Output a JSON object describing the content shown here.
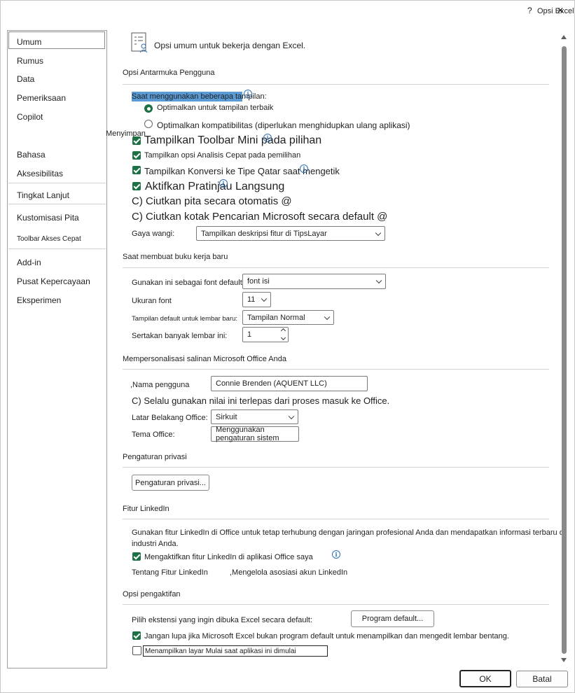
{
  "window": {
    "title": "Opsi Excel",
    "help": "?",
    "close": "✕"
  },
  "sidebar": {
    "items": [
      {
        "label": "Umum"
      },
      {
        "label": "Rumus"
      },
      {
        "label": "Data"
      },
      {
        "label": "Pemeriksaan"
      },
      {
        "label": "Copilot"
      },
      {
        "label": "Menyimpan"
      },
      {
        "label": "Bahasa"
      },
      {
        "label": "Aksesibilitas"
      },
      {
        "label": "Tingkat Lanjut"
      },
      {
        "label": "Kustomisasi Pita"
      },
      {
        "label": "Toolbar Akses Cepat"
      },
      {
        "label": "Add-in"
      },
      {
        "label": "Pusat Kepercayaan"
      },
      {
        "label": "Eksperimen"
      }
    ]
  },
  "header": {
    "title": "Opsi umum untuk bekerja dengan Excel."
  },
  "ui_section": {
    "title": "Opsi Antarmuka Pengguna",
    "multi_display_label": "Saat menggunakan beberapa tampilan:",
    "radio_best": "Optimalkan untuk tampilan terbaik",
    "radio_compat": "Optimalkan kompatibilitas (diperlukan menghidupkan ulang aplikasi)",
    "mini_toolbar": "Tampilkan Toolbar Mini pada pilihan",
    "quick_analysis": "Tampilkan opsi Analisis Cepat pada pemilihan",
    "convert_data": "Tampilkan Konversi ke Tipe Qatar saat mengetik",
    "live_preview": "Aktifkan Pratinjau Langsung",
    "collapse_ribbon": "C) Ciutkan pita secara otomatis @",
    "collapse_search": "C) Ciutkan kotak Pencarian Microsoft secara default @",
    "screentip_label": "Gaya wangi:",
    "screentip_value": "Tampilkan deskripsi fitur di TipsLayar"
  },
  "new_workbook": {
    "title": "Saat membuat buku kerja baru",
    "font_label": "Gunakan ini sebagai font default",
    "font_value": "font isi",
    "size_label": "Ukuran font",
    "size_value": "11",
    "view_label": "Tampilan default untuk lembar baru:",
    "view_value": "Tampilan Normal",
    "sheets_label": "Sertakan banyak lembar ini:",
    "sheets_value": "1"
  },
  "personalize": {
    "title": "Mempersonalisasi salinan Microsoft Office Anda",
    "username_label": ",Nama pengguna",
    "username_value": "Connie Brenden (AQUENT LLC)",
    "always_use": "C) Selalu gunakan nilai ini terlepas dari proses masuk ke Office.",
    "background_label": "Latar Belakang Office:",
    "background_value": "Sirkuit",
    "theme_label": "Tema Office:",
    "theme_value": "Menggunakan pengaturan sistem"
  },
  "privacy": {
    "title": "Pengaturan privasi",
    "button": "Pengaturan privasi..."
  },
  "linkedin": {
    "title": "Fitur LinkedIn",
    "desc_line1": "Gunakan fitur LinkedIn di Office untuk tetap terhubung dengan jaringan profesional Anda dan mendapatkan informasi terbaru di",
    "desc_line2": "industri Anda.",
    "enable": "Mengaktifkan fitur LinkedIn di aplikasi Office saya",
    "about_link": "Tentang Fitur LinkedIn",
    "manage_link": ",Mengelola asosiasi akun LinkedIn"
  },
  "startup": {
    "title": "Opsi pengaktifan",
    "extensions_label": "Pilih ekstensi yang ingin dibuka Excel secara default:",
    "default_programs_button": "Program default...",
    "tell_me": "Jangan lupa jika Microsoft Excel bukan program default untuk menampilkan dan mengedit lembar bentang.",
    "show_start": "Menampilkan layar Mulai saat aplikasi ini dimulai"
  },
  "footer": {
    "ok": "OK",
    "cancel": "Batal"
  },
  "colors": {
    "accent": "#1e7145",
    "highlight": "#5b9bd5",
    "info": "#2f6fb5"
  }
}
